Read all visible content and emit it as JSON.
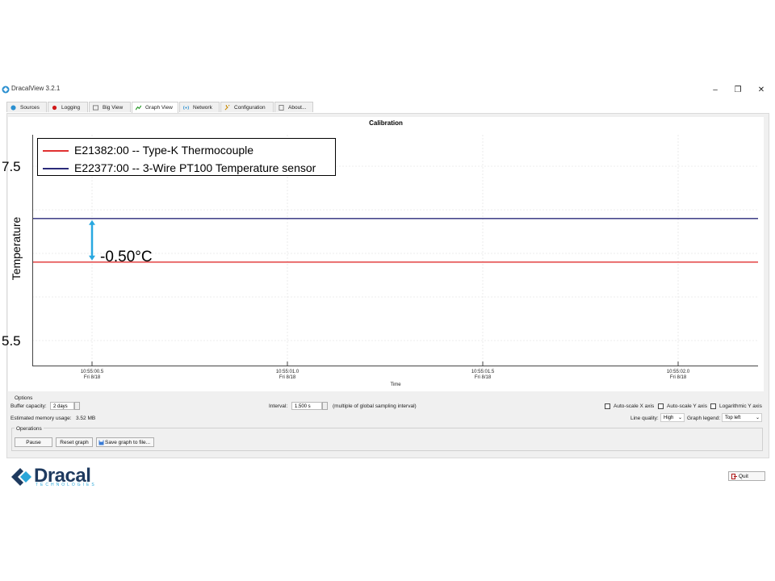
{
  "window": {
    "title": "DracalView 3.2.1",
    "minimize": "‒",
    "restore": "❐",
    "close": "✕"
  },
  "tabs": [
    {
      "label": "Sources",
      "icon": "sources-icon",
      "active": false
    },
    {
      "label": "Logging",
      "icon": "record-icon",
      "active": false
    },
    {
      "label": "Big View",
      "icon": "bigview-icon",
      "active": false
    },
    {
      "label": "Graph View",
      "icon": "graph-icon",
      "active": true
    },
    {
      "label": "Network",
      "icon": "network-icon",
      "active": false
    },
    {
      "label": "Configuration",
      "icon": "wrench-icon",
      "active": false
    },
    {
      "label": "About...",
      "icon": "about-icon",
      "active": false
    }
  ],
  "graph": {
    "title": "Calibration",
    "ylabel": "Temperature",
    "xlabel": "Time",
    "annotation": "-0.50°C"
  },
  "chart_data": {
    "type": "line",
    "title": "Calibration",
    "xlabel": "Time",
    "ylabel": "Temperature",
    "y_tick_labels": [
      "7.5",
      "5.5"
    ],
    "x_tick_labels": [
      {
        "time": "10:55:00.5",
        "date": "Fri 8/18"
      },
      {
        "time": "10:55:01.0",
        "date": "Fri 8/18"
      },
      {
        "time": "10:55:01.5",
        "date": "Fri 8/18"
      },
      {
        "time": "10:55:02.0",
        "date": "Fri 8/18"
      }
    ],
    "legend_position": "top-left",
    "grid": true,
    "series": [
      {
        "name": "E21382:00 -- Type-K Thermocouple",
        "color": "#e03030",
        "values": [
          6.4,
          6.4
        ]
      },
      {
        "name": "E22377:00 -- 3-Wire PT100 Temperature sensor",
        "color": "#2a2a7a",
        "values": [
          6.9,
          6.9
        ]
      }
    ],
    "difference_annotation": "-0.50°C"
  },
  "options": {
    "section_label": "Options",
    "buffer_label": "Buffer capacity:",
    "buffer_value": "2 days",
    "interval_label": "Interval:",
    "interval_value": "1.500 s",
    "interval_hint": "(multiple of global sampling interval)",
    "autoscale_x": "Auto-scale X axis",
    "autoscale_y": "Auto-scale Y axis",
    "log_y": "Logarithmic Y axis",
    "memory_label": "Estimated memory usage:",
    "memory_value": "3.52 MB",
    "line_quality_label": "Line quality:",
    "line_quality_value": "High",
    "legend_label": "Graph legend:",
    "legend_value": "Top left"
  },
  "operations": {
    "section_label": "Operations",
    "pause": "Pause",
    "reset": "Reset graph",
    "save": "Save graph to file..."
  },
  "footer": {
    "logo": "Dracal",
    "logo_sub": "TECHNOLOGIES",
    "quit": "Quit"
  }
}
